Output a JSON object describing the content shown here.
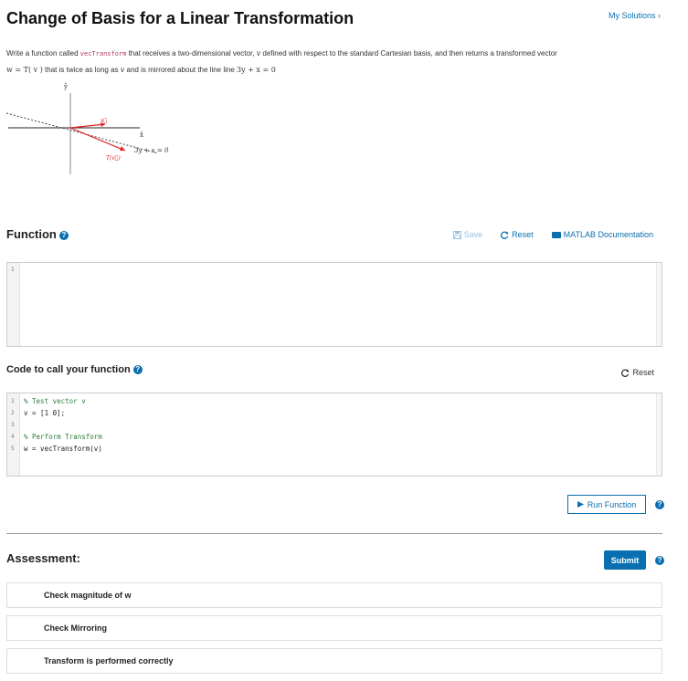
{
  "header": {
    "title": "Change of Basis for a Linear Transformation",
    "my_solutions": "My Solutions ›"
  },
  "description": {
    "part1": "Write a function called ",
    "code_name": "vecTransform",
    "part2": " that receives a two-dimensional vector, ",
    "v_symbol": "v",
    "part3": " defined with respect to the standard Cartesian basis, and then returns a transformed vector",
    "formula": "w = T( v )",
    "part4": " that is twice as long as ",
    "v_symbol2": "v",
    "part5": " and is mirrored about the line line ",
    "line_eq": "3y + x = 0"
  },
  "diagram": {
    "y_label": "ŷ",
    "x_label": "x̂",
    "v_label": "v⃗",
    "tv_label": "T(v⃗)",
    "line_label": "3y + x = 0"
  },
  "function_section": {
    "heading": "Function",
    "save_label": "Save",
    "reset_label": "Reset",
    "doc_label": "MATLAB Documentation",
    "editor_lines": [
      ""
    ],
    "line_numbers": [
      "1"
    ]
  },
  "call_section": {
    "heading": "Code to call your function",
    "reset_label": "Reset",
    "line_numbers": [
      "1",
      "2",
      "3",
      "4",
      "5"
    ],
    "code_lines": [
      {
        "text": "% Test vector v",
        "type": "comment"
      },
      {
        "text": "v = [1 0];",
        "type": "code"
      },
      {
        "text": "",
        "type": "code"
      },
      {
        "text": "% Perform Transform",
        "type": "comment"
      },
      {
        "text": "w = vecTransform(v)",
        "type": "code"
      }
    ]
  },
  "run_button": "Run Function",
  "assessment": {
    "heading": "Assessment:",
    "submit_label": "Submit",
    "items": [
      "Check magnitude of w",
      "Check Mirroring",
      "Transform is performed correctly"
    ]
  },
  "colors": {
    "accent": "#0a6fb0",
    "vector_red": "#e02020",
    "comment_green": "#2a7f3c"
  }
}
